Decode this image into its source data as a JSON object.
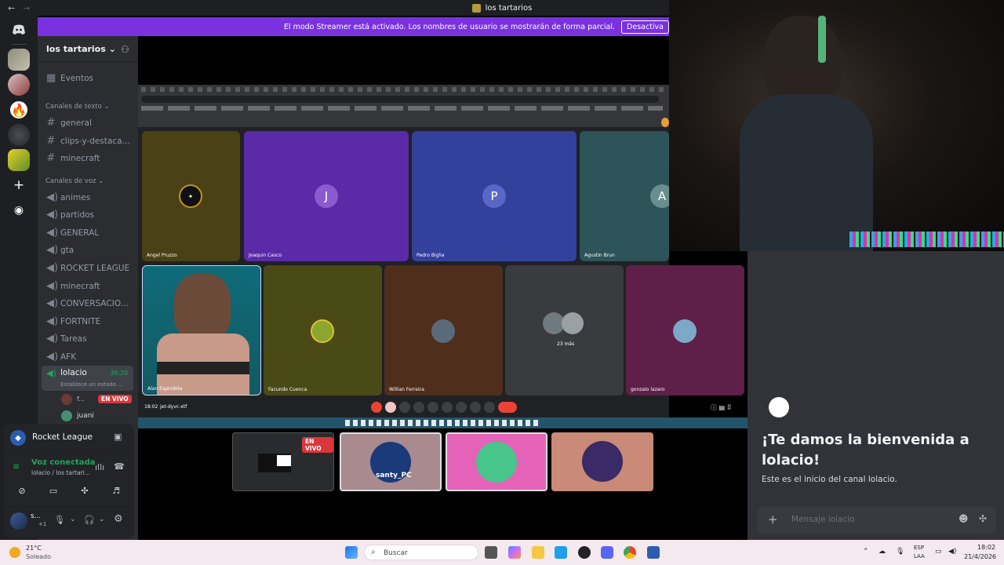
{
  "window": {
    "title": "los tartarios"
  },
  "banner": {
    "text": "El modo Streamer está activado. Los nombres de usuario se mostrarán de forma parcial.",
    "button": "Desactiva"
  },
  "server": {
    "name": "los tartarios"
  },
  "sidebar": {
    "events": "Eventos",
    "text_category": "Canales de texto",
    "text_channels": [
      "general",
      "clips-y-destaca...",
      "minecraft"
    ],
    "voice_category": "Canales de voz",
    "voice_channels": [
      "animes",
      "partidos",
      "GENERAL",
      "gta",
      "ROCKET LEAGUE",
      "minecraft",
      "CONVERSACIO...",
      "FORTNITE",
      "Tareas",
      "AFK"
    ],
    "active_voice": {
      "name": "lolacio",
      "timer": "36:20",
      "status": "Establece un estado ..."
    },
    "members": [
      {
        "name": "f...",
        "badge": "EN VIVO"
      },
      {
        "name": "juani"
      }
    ]
  },
  "activity": {
    "game": "Rocket League"
  },
  "voice_status": {
    "title": "Voz conectada",
    "subtitle": "lolacio / los tartari..."
  },
  "user": {
    "name": "s...",
    "tag": "+1"
  },
  "meet": {
    "tiles": [
      {
        "name": "Angel Pruzzo"
      },
      {
        "name": "Joaquin Casco",
        "initial": "J"
      },
      {
        "name": "Pedro Biglia",
        "initial": "P"
      },
      {
        "name": "Agustin Brun",
        "initial": "A"
      },
      {
        "name": "Alan Espindola"
      },
      {
        "name": "Facundo Cuenca"
      },
      {
        "name": "Willian Ferreira"
      },
      {
        "name": "",
        "more": "23 más"
      },
      {
        "name": "gonzalo lazaro"
      }
    ],
    "time": "18:02",
    "code": "jet-dyvc-xtf"
  },
  "streams": [
    {
      "badge": "EN VIVO"
    },
    {
      "label": "santy_PC"
    },
    {},
    {}
  ],
  "chat": {
    "welcome": "¡Te damos la bienvenida a lolacio!",
    "sub": "Este es el inicio del canal lolacio.",
    "placeholder": "Mensaje lolacio"
  },
  "taskbar": {
    "temp": "21°C",
    "weather": "Soleado",
    "search": "Buscar",
    "lang1": "ESP",
    "lang2": "LAA",
    "time": "18:02",
    "date": "21/4/2026"
  }
}
